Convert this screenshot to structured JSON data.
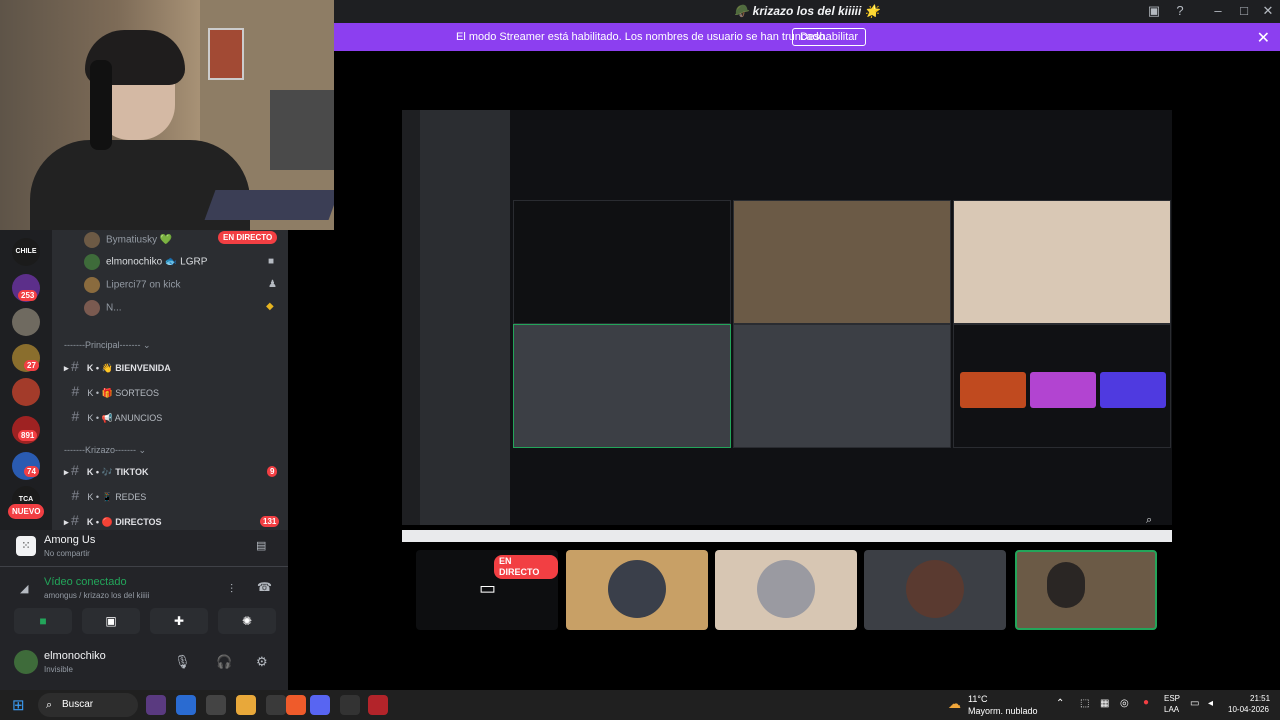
{
  "window": {
    "title": "krizazo los del kiiiii",
    "title_prefix_icon": "helmet-emoji",
    "title_suffix_icon": "sparkle-emoji"
  },
  "banner": {
    "message": "El modo Streamer está habilitado. Los nombres de usuario se han truncado.",
    "button": "Deshabilitar"
  },
  "rail": {
    "servers": [
      "CHILE",
      "253",
      "27",
      "891",
      "74",
      "TCA",
      "NUEVO"
    ]
  },
  "voice_users": [
    {
      "name": "Bymatiusky",
      "badge": "EN DIRECTO"
    },
    {
      "name": "elmonochiko",
      "tag": "LGRP"
    },
    {
      "name": "Liperci77 on kick"
    },
    {
      "name": "N..."
    }
  ],
  "categories": [
    {
      "label": "-------Principal-------"
    },
    {
      "label": "-------Krizazo-------"
    }
  ],
  "channels": [
    {
      "prefix": "K",
      "label": "BIENVENIDA",
      "bold": true
    },
    {
      "prefix": "K",
      "label": "SORTEOS",
      "bold": false
    },
    {
      "prefix": "K",
      "label": "ANUNCIOS",
      "bold": false
    },
    {
      "prefix": "K",
      "label": "TIKTOK",
      "bold": true,
      "count": "9"
    },
    {
      "prefix": "K",
      "label": "REDES",
      "bold": false
    },
    {
      "prefix": "K",
      "label": "DIRECTOS",
      "bold": true,
      "count": "131"
    }
  ],
  "activity": {
    "game": "Among Us",
    "status": "No compartir"
  },
  "connection": {
    "status": "Vídeo conectado",
    "detail": "amongus / krizazo los del kiiiii"
  },
  "user": {
    "name": "elmonochiko",
    "status": "Invisible"
  },
  "stage": {
    "live_badge": "EN DIRECTO"
  },
  "taskbar": {
    "search_placeholder": "Buscar",
    "weather_temp": "11°C",
    "weather_desc": "Mayorm. nublado",
    "lang": "ESP",
    "lang2": "LAA",
    "time": "21:51",
    "date": "10-04-2026"
  },
  "colors": {
    "accent": "#8c3ff0",
    "live": "#f23f43",
    "connected": "#23a55a"
  }
}
